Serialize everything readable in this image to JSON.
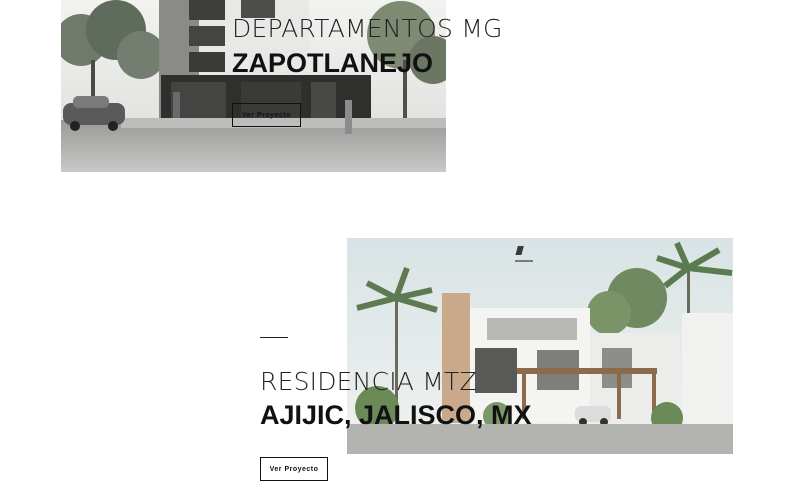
{
  "projects": [
    {
      "title": "DEPARTAMENTOS MG",
      "location": "ZAPOTLANEJO",
      "button_label": "Ver Proyecto"
    },
    {
      "title": "RESIDENCIA MTZ",
      "location": "AJIJIC, JALISCO, MX",
      "button_label": "Ver Proyecto"
    }
  ]
}
